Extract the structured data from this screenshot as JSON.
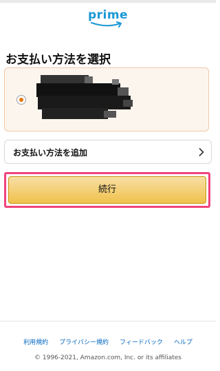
{
  "brand": {
    "logo_text": "prime",
    "logo_color": "#1a98d5"
  },
  "page": {
    "title": "お支払い方法を選択"
  },
  "payment_method": {
    "selected": true,
    "details_redacted": true
  },
  "add_payment": {
    "label": "お支払い方法を追加",
    "icon": "chevron-right-icon"
  },
  "continue_button": {
    "label": "続行",
    "highlight_color": "#f0437a",
    "button_color": "#f0c14b"
  },
  "footer": {
    "links": [
      "利用規約",
      "プライバシー規約",
      "フィードバック",
      "ヘルプ"
    ],
    "copyright": "© 1996-2021, Amazon.com, Inc. or its affiliates"
  },
  "colors": {
    "selected_card_bg": "#fcf5ee",
    "radio_accent": "#e77600",
    "link": "#0066c0"
  }
}
